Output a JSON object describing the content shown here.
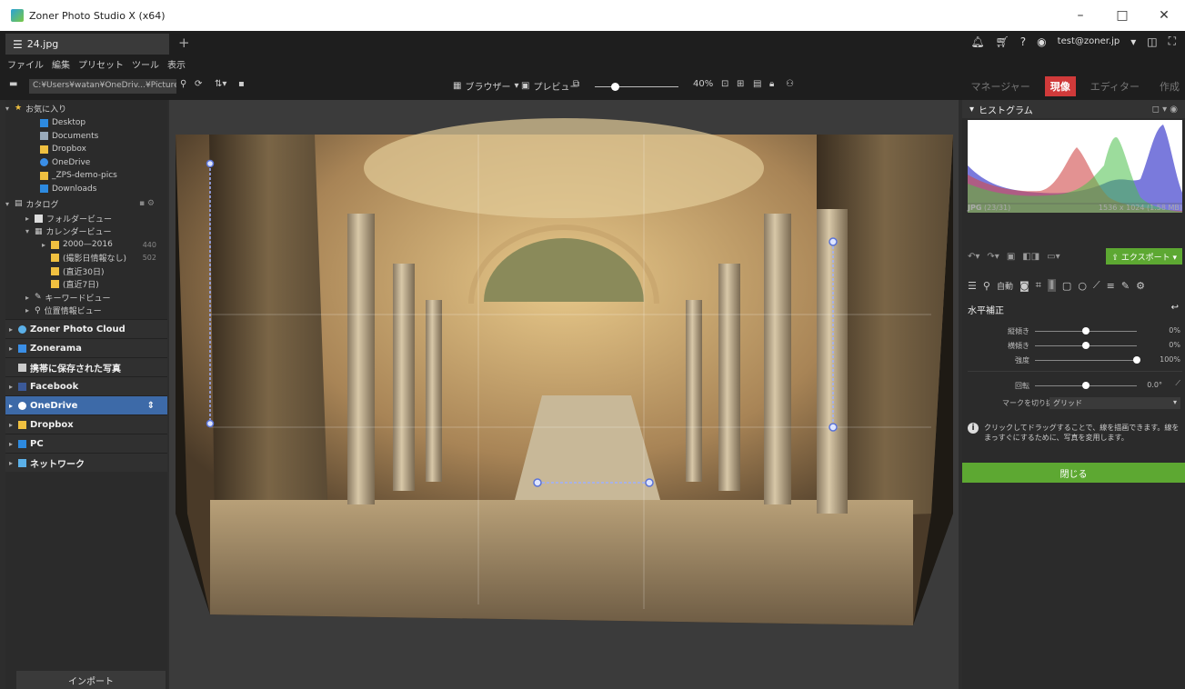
{
  "window": {
    "title": "Zoner Photo Studio X (x64)",
    "minimize": "–",
    "maximize": "□",
    "close": "✕"
  },
  "tabs": {
    "active": "24.jpg",
    "new": "+"
  },
  "account": {
    "email": "test@zoner.jp"
  },
  "menu": [
    "ファイル",
    "編集",
    "プリセット",
    "ツール",
    "表示"
  ],
  "toolbar": {
    "path": "C:¥Users¥watan¥OneDriv...¥Pictures",
    "browser": "ブラウザー",
    "preview": "プレビュー",
    "zoom": "40%",
    "zoom_fraction": 0.24
  },
  "modes": [
    {
      "label": "マネージャー",
      "active": false
    },
    {
      "label": "現像",
      "active": true
    },
    {
      "label": "エディター",
      "active": false
    },
    {
      "label": "作成",
      "active": false
    }
  ],
  "favorites": {
    "title": "お気に入り",
    "items": [
      "Desktop",
      "Documents",
      "Dropbox",
      "OneDrive",
      "_ZPS-demo-pics",
      "Downloads"
    ]
  },
  "catalog": {
    "title": "カタログ",
    "folder_view": "フォルダービュー",
    "calendar_view": "カレンダービュー",
    "years": "2000—2016",
    "years_count": "440",
    "no_date": "(撮影日情報なし)",
    "no_date_count": "502",
    "last30": "(直近30日)",
    "last7": "(直近7日)",
    "keyword_view": "キーワードビュー",
    "location_view": "位置情報ビュー"
  },
  "sources": [
    "Zoner Photo Cloud",
    "Zonerama",
    "携帯に保存された写真",
    "Facebook",
    "OneDrive",
    "Dropbox",
    "PC",
    "ネットワーク"
  ],
  "import_label": "インポート",
  "histogram": {
    "title": "ヒストグラム",
    "format": "JPG",
    "index": "(23/31)",
    "size": "1536 x 1024 (1.58 MB)"
  },
  "actions": {
    "export": "エクスポート"
  },
  "tools": {
    "auto": "自動"
  },
  "panel": {
    "title": "水平補正",
    "sliders": [
      {
        "label": "縦傾き",
        "value": "0%",
        "fraction": 0.5
      },
      {
        "label": "横傾き",
        "value": "0%",
        "fraction": 0.5
      },
      {
        "label": "強度",
        "value": "100%",
        "fraction": 1.0
      }
    ],
    "rotate": {
      "label": "回転",
      "value": "0.0°",
      "fraction": 0.5
    },
    "mark": {
      "label": "マークを切り抜く",
      "value": "グリッド"
    },
    "hint": "クリックしてドラッグすることで、線を描画できます。線をまっすぐにするために、写真を変用します。",
    "close": "閉じる"
  },
  "colors": {
    "accent_red": "#d03a3a",
    "accent_green": "#5da832",
    "selected_blue": "#3d6aa8"
  }
}
